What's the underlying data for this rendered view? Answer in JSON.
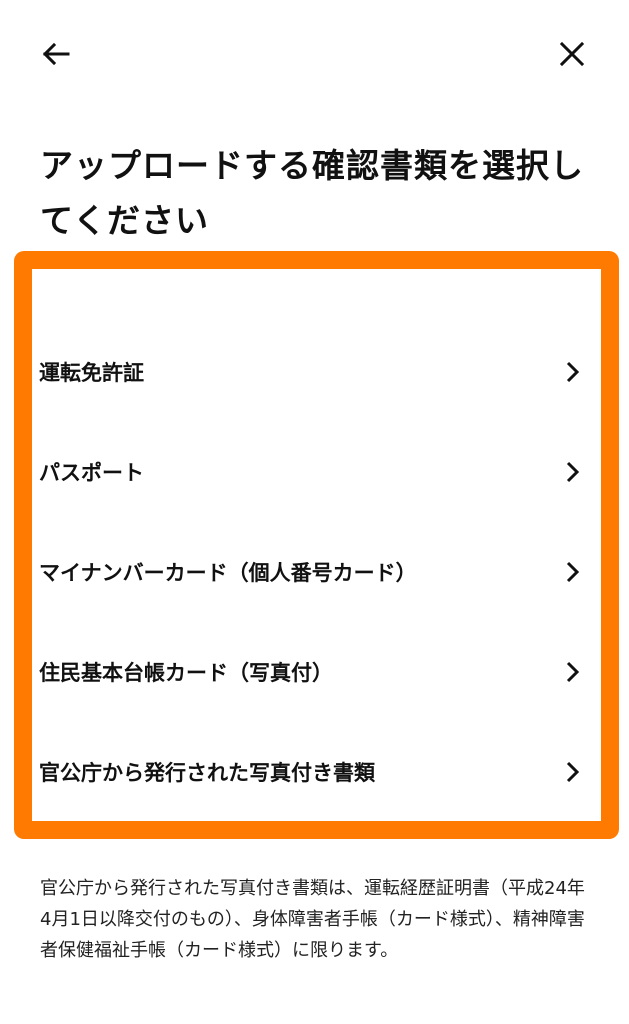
{
  "header": {
    "back_icon": "arrow-left-icon",
    "close_icon": "close-icon"
  },
  "title": "アップロードする確認書類を選択してください",
  "list_accent_color": "#ff7a00",
  "document_types": [
    {
      "label": "運転免許証",
      "icon": "chevron-right-icon"
    },
    {
      "label": "パスポート",
      "icon": "chevron-right-icon"
    },
    {
      "label": "マイナンバーカード（個人番号カード）",
      "icon": "chevron-right-icon"
    },
    {
      "label": "住民基本台帳カード（写真付）",
      "icon": "chevron-right-icon"
    },
    {
      "label": "官公庁から発行された写真付き書類",
      "icon": "chevron-right-icon"
    }
  ],
  "note": "官公庁から発行された写真付き書類は、運転経歴証明書（平成24年4月1日以降交付のもの）、身体障害者手帳（カード様式）、精神障害者保健福祉手帳（カード様式）に限ります。"
}
